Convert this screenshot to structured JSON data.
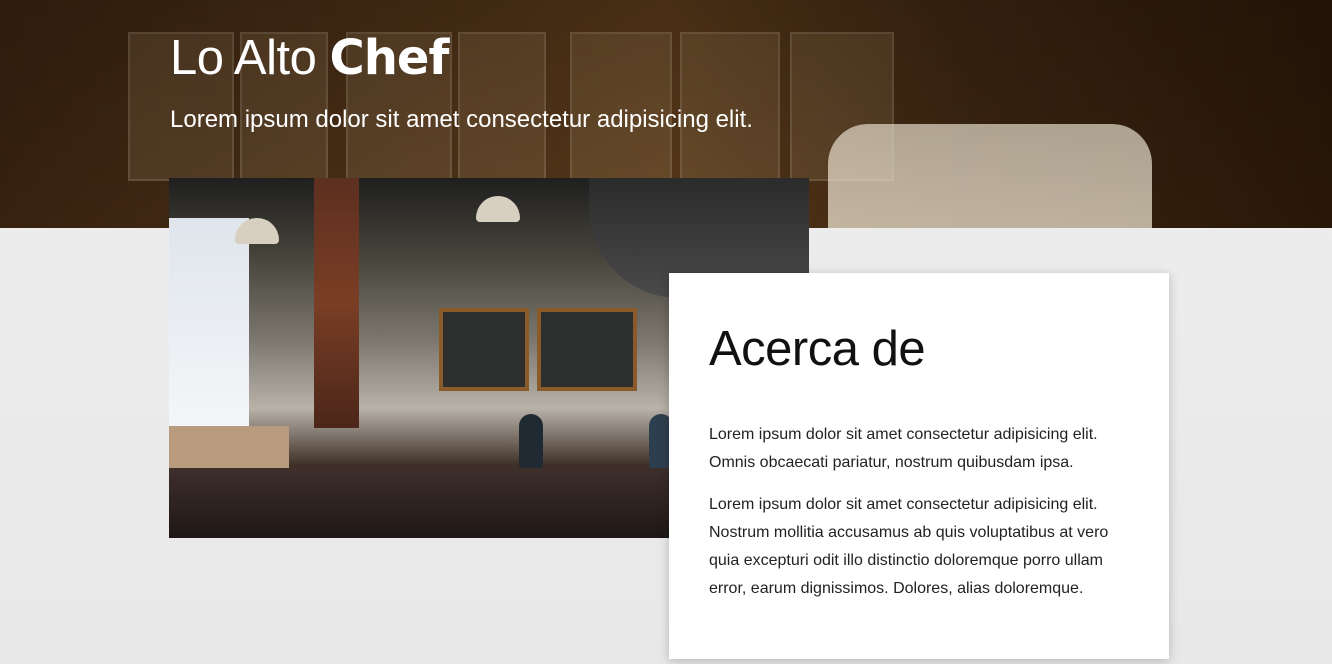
{
  "hero": {
    "brand_light": "Lo Alto",
    "brand_bold": "Chef",
    "tagline": "Lorem ipsum dolor sit amet consectetur adipisicing elit."
  },
  "about": {
    "title": "Acerca de",
    "paragraphs": [
      "Lorem ipsum dolor sit amet consectetur adipisicing elit. Omnis obcaecati pariatur, nostrum quibusdam ipsa.",
      "Lorem ipsum dolor sit amet consectetur adipisicing elit. Nostrum mollitia accusamus ab quis voluptatibus at vero quia excepturi odit illo distinctio doloremque porro ullam error, earum dignissimos. Dolores, alias doloremque."
    ]
  },
  "colors": {
    "hero_overlay": "#3a2310",
    "card_background": "#ffffff",
    "page_background": "#ececec",
    "text_primary": "#111111"
  },
  "images": {
    "hero_image": "cafe-interior-banner",
    "about_image": "coffee-shop-photo"
  }
}
